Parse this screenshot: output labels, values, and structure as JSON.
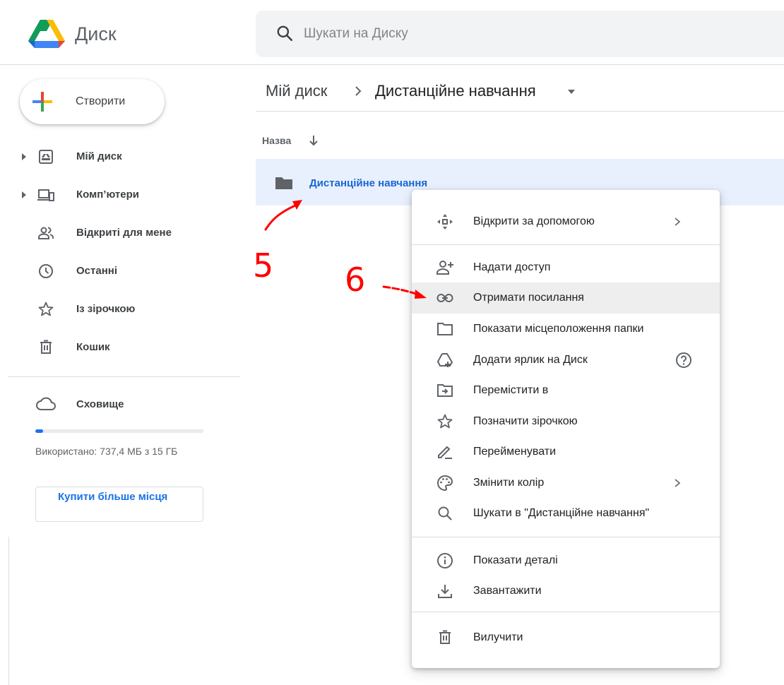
{
  "header": {
    "app_title": "Диск",
    "search_placeholder": "Шукати на Диску"
  },
  "sidebar": {
    "create_label": "Створити",
    "items": [
      {
        "label": "Мій диск",
        "icon": "my-drive-icon",
        "expandable": true
      },
      {
        "label": "Комп’ютери",
        "icon": "computers-icon",
        "expandable": true
      },
      {
        "label": "Відкриті для мене",
        "icon": "shared-people-icon",
        "expandable": false
      },
      {
        "label": "Останні",
        "icon": "clock-icon",
        "expandable": false
      },
      {
        "label": "Із зірочкою",
        "icon": "star-icon",
        "expandable": false
      },
      {
        "label": "Кошик",
        "icon": "trash-icon",
        "expandable": false
      }
    ],
    "storage": {
      "label": "Сховище",
      "used_text": "Використано: 737,4 МБ з 15 ГБ",
      "used_fraction": 0.048,
      "buy_label": "Купити більше місця"
    }
  },
  "main": {
    "breadcrumb": {
      "root": "Мій диск",
      "current": "Дистанційне навчання"
    },
    "column_name": "Назва",
    "files": [
      {
        "name": "Дистанційне навчання",
        "type": "folder",
        "selected": true
      }
    ]
  },
  "context_menu": {
    "items": [
      {
        "label": "Відкрити за допомогою",
        "icon": "open-with-icon",
        "submenu": true
      },
      {
        "label": "Надати доступ",
        "icon": "share-person-add-icon"
      },
      {
        "label": "Отримати посилання",
        "icon": "link-icon",
        "highlighted": true
      },
      {
        "label": "Показати місцеположення папки",
        "icon": "folder-outline-icon"
      },
      {
        "label": "Додати ярлик на Диск",
        "icon": "add-shortcut-icon",
        "help": true
      },
      {
        "label": "Перемістити в",
        "icon": "move-to-icon"
      },
      {
        "label": "Позначити зірочкою",
        "icon": "star-outline-icon"
      },
      {
        "label": "Перейменувати",
        "icon": "rename-pencil-icon"
      },
      {
        "label": "Змінити колір",
        "icon": "palette-icon",
        "submenu": true
      },
      {
        "label": "Шукати в \"Дистанційне навчання\"",
        "icon": "search-icon"
      },
      {
        "label": "Показати деталі",
        "icon": "info-icon"
      },
      {
        "label": "Завантажити",
        "icon": "download-icon"
      },
      {
        "label": "Вилучити",
        "icon": "trash-icon"
      }
    ]
  },
  "annotations": [
    {
      "number": "5",
      "color": "#ff0000"
    },
    {
      "number": "6",
      "color": "#ff0000"
    }
  ],
  "colors": {
    "accent": "#1a73e8",
    "selected_row": "#e8f0fe",
    "annotation": "#ff0000"
  }
}
